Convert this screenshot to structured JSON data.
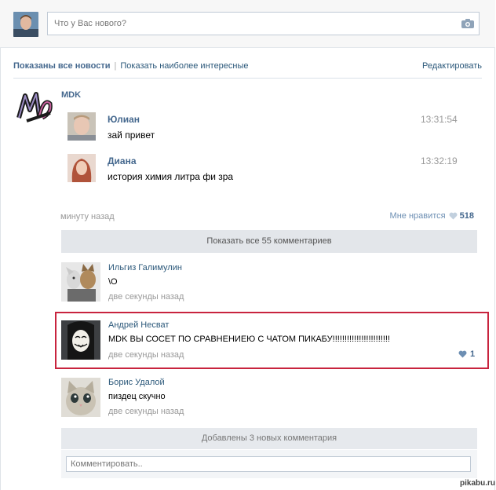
{
  "composer": {
    "placeholder": "Что у Вас нового?"
  },
  "filters": {
    "active": "Показаны все новости",
    "other": "Показать наиболее интересные",
    "edit": "Редактировать"
  },
  "post": {
    "group_name": "MDK",
    "messages": [
      {
        "author": "Юлиан",
        "text": "зай привет",
        "time": "13:31:54"
      },
      {
        "author": "Диана",
        "text": "история химия литра фи зра",
        "time": "13:32:19"
      }
    ],
    "posted": "минуту назад",
    "like_label": "Мне нравится",
    "like_count": "518",
    "show_all": "Показать все 55 комментариев"
  },
  "comments": [
    {
      "author": "Ильгиз Галимулин",
      "text": "\\O",
      "time": "две секунды назад"
    },
    {
      "author": "Андрей Несват",
      "text": "MDK ВЫ СОСЕТ ПО СРАВНЕНИЕЮ С ЧАТОМ ПИКАБУ!!!!!!!!!!!!!!!!!!!!!!!!",
      "time": "две секунды назад",
      "likes": "1"
    },
    {
      "author": "Борис Удалой",
      "text": "пиздец скучно",
      "time": "две секунды назад"
    }
  ],
  "added_notice": "Добавлены 3 новых комментария",
  "comment_input": {
    "placeholder": "Комментировать.."
  },
  "watermark": "pikabu.ru",
  "colors": {
    "link": "#2b587a",
    "accent": "#45688e",
    "highlight": "#c8243e"
  }
}
